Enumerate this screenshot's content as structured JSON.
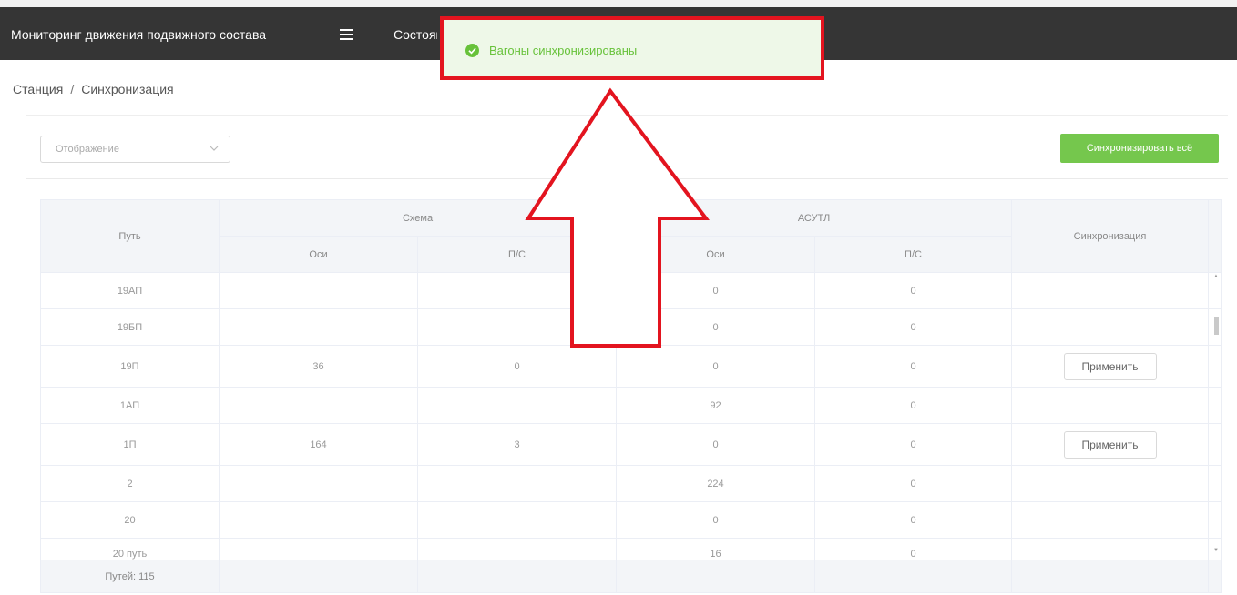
{
  "header": {
    "app_title": "Мониторинг движения подвижного состава",
    "menu_icon": "hamburger-icon",
    "nav_item": "Состояние"
  },
  "breadcrumb": {
    "items": [
      "Станция",
      "Синхронизация"
    ],
    "separator": "/"
  },
  "toolbar": {
    "select_placeholder": "Отображение",
    "sync_all_label": "Синхронизировать всё"
  },
  "toast": {
    "message": "Вагоны синхронизированы",
    "icon": "check-circle-icon",
    "color": "#67c23a",
    "highlight_color": "#e3141f"
  },
  "table": {
    "headers": {
      "path": "Путь",
      "scheme": "Схема",
      "asutl": "АСУТЛ",
      "sync": "Синхронизация",
      "axles": "Оси",
      "ps": "П/С"
    },
    "rows": [
      {
        "path": "19АП",
        "scheme_axles": "",
        "scheme_ps": "",
        "asutl_axles": "0",
        "asutl_ps": "0",
        "action": ""
      },
      {
        "path": "19БП",
        "scheme_axles": "",
        "scheme_ps": "",
        "asutl_axles": "0",
        "asutl_ps": "0",
        "action": ""
      },
      {
        "path": "19П",
        "scheme_axles": "36",
        "scheme_ps": "0",
        "asutl_axles": "0",
        "asutl_ps": "0",
        "action": "Применить"
      },
      {
        "path": "1АП",
        "scheme_axles": "",
        "scheme_ps": "",
        "asutl_axles": "92",
        "asutl_ps": "0",
        "action": ""
      },
      {
        "path": "1П",
        "scheme_axles": "164",
        "scheme_ps": "3",
        "asutl_axles": "0",
        "asutl_ps": "0",
        "action": "Применить"
      },
      {
        "path": "2",
        "scheme_axles": "",
        "scheme_ps": "",
        "asutl_axles": "224",
        "asutl_ps": "0",
        "action": ""
      },
      {
        "path": "20",
        "scheme_axles": "",
        "scheme_ps": "",
        "asutl_axles": "0",
        "asutl_ps": "0",
        "action": ""
      },
      {
        "path": "20 путь",
        "scheme_axles": "",
        "scheme_ps": "",
        "asutl_axles": "16",
        "asutl_ps": "0",
        "action": ""
      }
    ],
    "footer": "Путей: 115"
  }
}
